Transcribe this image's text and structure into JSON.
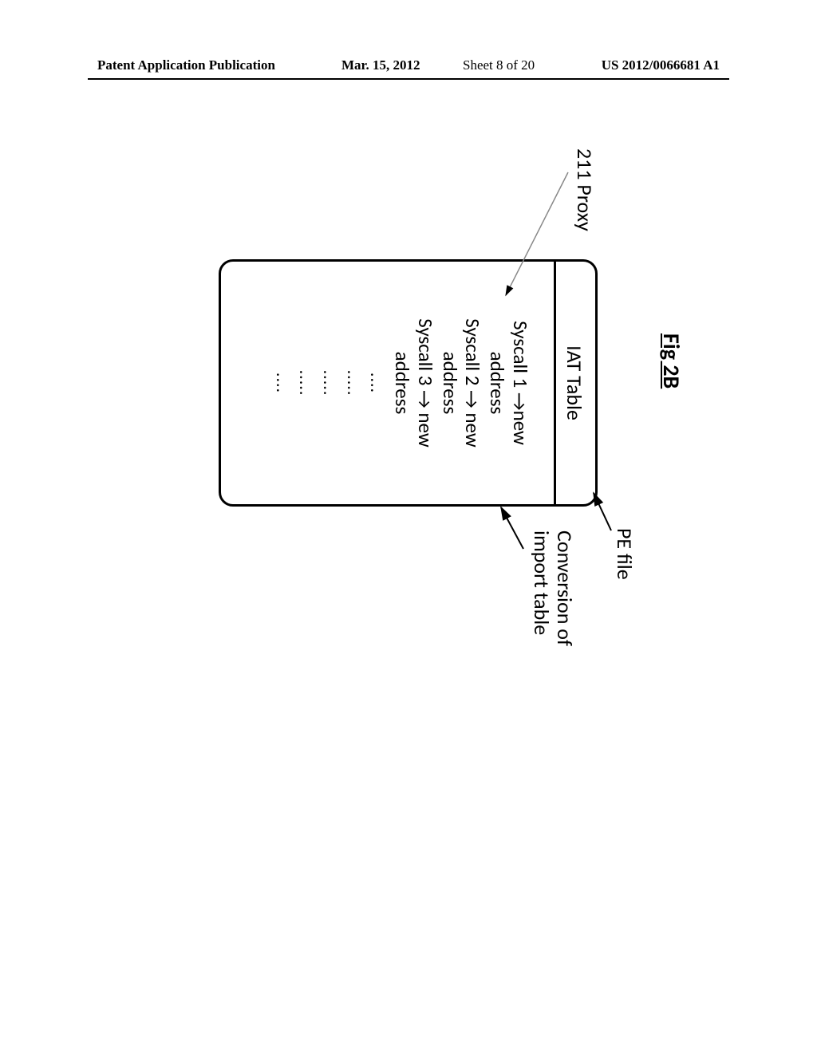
{
  "header": {
    "left": "Patent Application Publication",
    "date": "Mar. 15, 2012",
    "page": "Sheet 8 of 20",
    "pubno": "US 2012/0066681 A1"
  },
  "figure": {
    "title": "Fig 2B",
    "pe_file_label": "PE file",
    "proxy_label": "211 Proxy",
    "conversion_label_line1": "Conversion of",
    "conversion_label_line2": "import table",
    "iat_table_header": "IAT Table",
    "rows": [
      {
        "left": "Syscall 1",
        "right": "new",
        "sub": "address"
      },
      {
        "left": "Syscall 2",
        "right": "new",
        "sub": "address"
      },
      {
        "left": "Syscall 3",
        "right": "new",
        "sub": "address"
      }
    ],
    "dots": [
      "....",
      ".....",
      ".....",
      ".....",
      "...."
    ]
  }
}
